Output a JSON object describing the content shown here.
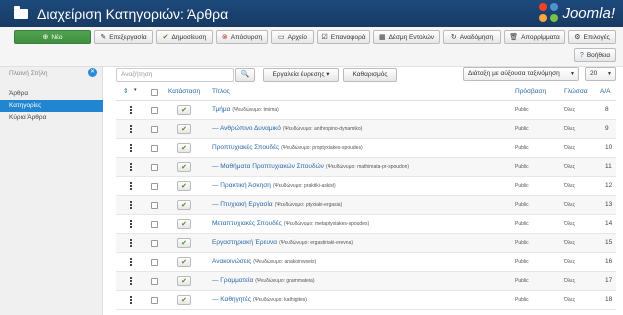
{
  "header": {
    "title": "Διαχείριση Κατηγοριών: Άρθρα",
    "logo_text": "Joomla!"
  },
  "toolbar": {
    "new": "Νέο",
    "edit": "Επεξεργασία",
    "publish": "Δημοσίευση",
    "unpublish": "Απόσυρση",
    "archive": "Αρχείο",
    "checkin": "Επαναφορά",
    "batch": "Δέσμη Εντολών",
    "rebuild": "Αναδόμηση",
    "trash": "Απορρίμματα",
    "options": "Επιλογές",
    "help": "Βοήθεια"
  },
  "sidebar": {
    "filter_label": "Πλαινή Στήλη",
    "items": [
      {
        "label": "Άρθρα"
      },
      {
        "label": "Κατηγορίες"
      },
      {
        "label": "Κύρια Άρθρα"
      }
    ]
  },
  "filters": {
    "search_placeholder": "Αναζήτηση",
    "tools_label": "Εργαλεία έυρεσης ▾",
    "clear_label": "Καθαρισμός",
    "sort_label": "Διάταξη με αύξουσα ταξινόμηση",
    "limit_value": "20"
  },
  "table": {
    "headers": {
      "status": "Κατάσταση",
      "title": "Τίτλος",
      "access": "Πρόσβαση",
      "language": "Γλώσσα",
      "id": "Α/Α"
    },
    "rows": [
      {
        "title": "Τμήμα",
        "alias": "(Ψευδώνυμο: tmima)",
        "access": "Public",
        "language": "Όλες",
        "id": "8"
      },
      {
        "title": "— Ανθρώπινο Δυναμικό",
        "alias": "(Ψευδώνυμο: anthropino-dynamiko)",
        "access": "Public",
        "language": "Όλες",
        "id": "9"
      },
      {
        "title": "Προπτυχιακές Σπουδές",
        "alias": "(Ψευδώνυμο: proptyxiakes-spoudes)",
        "access": "Public",
        "language": "Όλες",
        "id": "10"
      },
      {
        "title": "— Μαθήματα Προπτυχιακών Σπουδών",
        "alias": "(Ψευδώνυμο: mathimata-pr-spoudon)",
        "access": "Public",
        "language": "Όλες",
        "id": "11"
      },
      {
        "title": "— Πρακτική Άσκηση",
        "alias": "(Ψευδώνυμο: praktiki-askisi)",
        "access": "Public",
        "language": "Όλες",
        "id": "12"
      },
      {
        "title": "— Πτυχιακή Εργασία",
        "alias": "(Ψευδώνυμο: ptyxiaki-ergasia)",
        "access": "Public",
        "language": "Όλες",
        "id": "13"
      },
      {
        "title": "Μεταπτυχιακές Σπουδές",
        "alias": "(Ψευδώνυμο: metaptyxiakes-spoudes)",
        "access": "Public",
        "language": "Όλες",
        "id": "14"
      },
      {
        "title": "Εργαστηριακή Έρευνα",
        "alias": "(Ψευδώνυμο: ergastiriaki-erevna)",
        "access": "Public",
        "language": "Όλες",
        "id": "15"
      },
      {
        "title": "Ανακοινώσεις",
        "alias": "(Ψευδώνυμο: anakoinwseis)",
        "access": "Public",
        "language": "Όλες",
        "id": "16"
      },
      {
        "title": "— Γραμματεία",
        "alias": "(Ψευδώνυμο: grammateia)",
        "access": "Public",
        "language": "Όλες",
        "id": "17"
      },
      {
        "title": "— Καθηγητές",
        "alias": "(Ψευδώνυμο: kathigites)",
        "access": "Public",
        "language": "Όλες",
        "id": "18"
      }
    ]
  },
  "colors": {
    "header_bg": "#1b3f6b",
    "accent": "#2185d0",
    "new_button": "#51a351",
    "link": "#2a6aa8"
  }
}
